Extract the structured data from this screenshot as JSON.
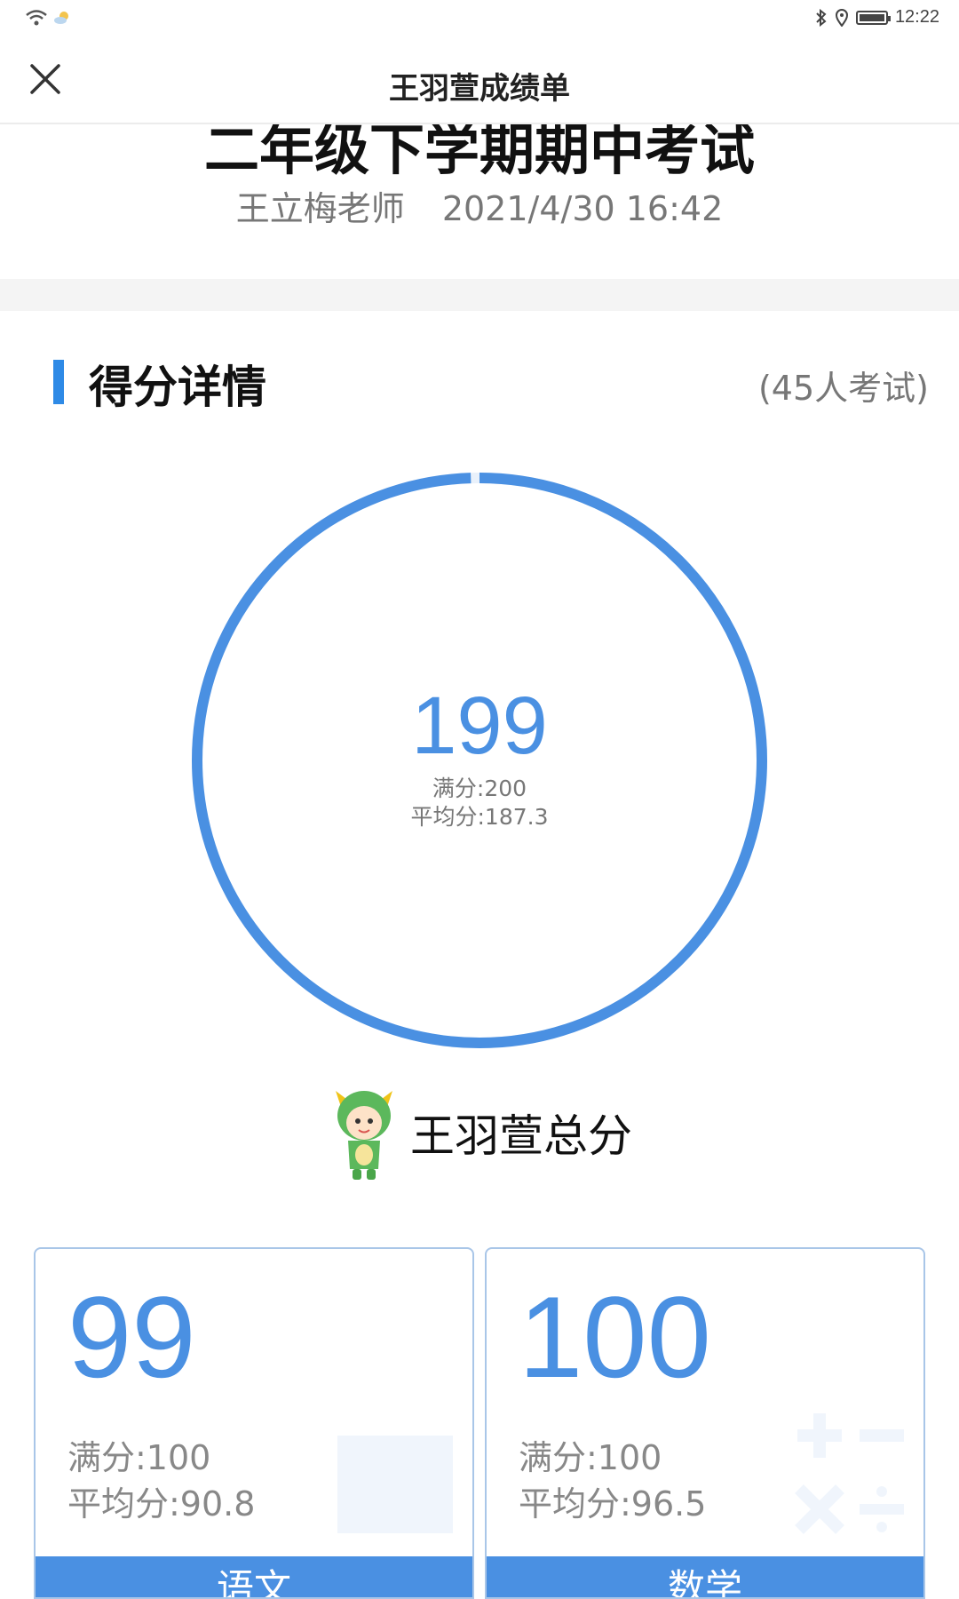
{
  "status_bar": {
    "time": "12:22"
  },
  "header": {
    "title": "王羽萱成绩单"
  },
  "exam": {
    "title": "二年级下学期期中考试",
    "teacher": "王立梅老师",
    "datetime": "2021/4/30 16:42"
  },
  "details": {
    "section_title": "得分详情",
    "participants": "(45人考试)",
    "total": {
      "score": "199",
      "full": "满分:200",
      "average": "平均分:187.3",
      "score_fraction": 0.995
    },
    "student_label": "王羽萱总分"
  },
  "subjects": [
    {
      "score": "99",
      "full": "满分:100",
      "average": "平均分:90.8",
      "name": "语文"
    },
    {
      "score": "100",
      "full": "满分:100",
      "average": "平均分:96.5",
      "name": "数学"
    }
  ],
  "colors": {
    "accent": "#4a90e2",
    "section_bar": "#2e8ae6",
    "ring": "#4a90e2"
  }
}
